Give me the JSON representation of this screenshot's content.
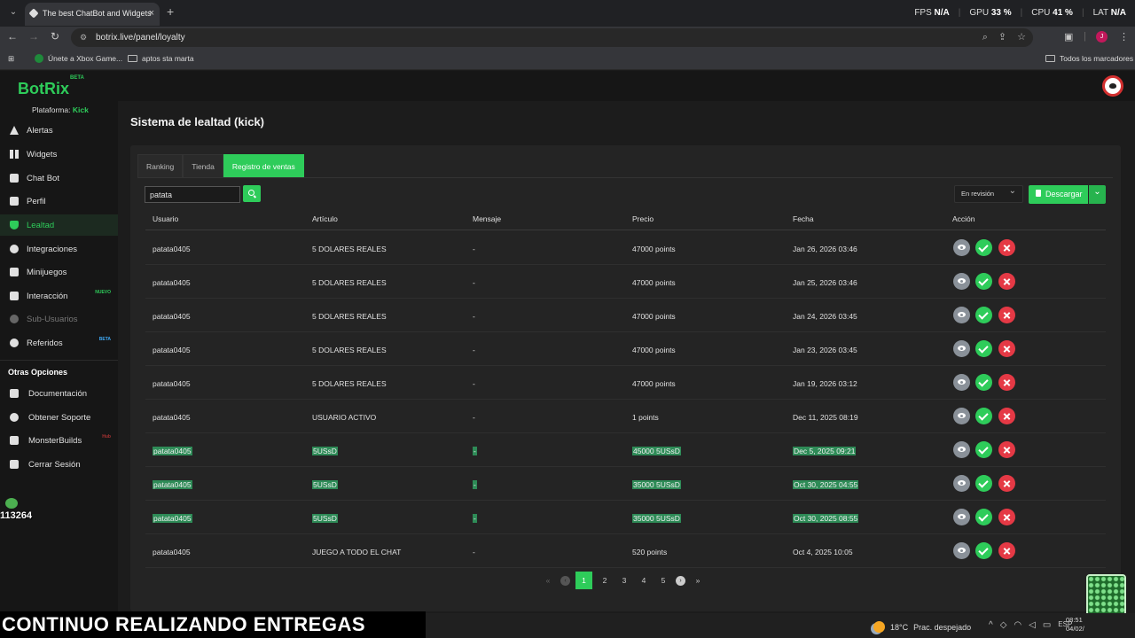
{
  "browser": {
    "tab_title": "The best ChatBot and Widgets",
    "new_tab": "+",
    "url": "botrix.live/panel/loyalty",
    "perf": [
      {
        "label": "FPS",
        "value": "N/A"
      },
      {
        "label": "GPU",
        "value": "33 %"
      },
      {
        "label": "CPU",
        "value": "41 %"
      },
      {
        "label": "LAT",
        "value": "N/A"
      }
    ],
    "profile_initial": "J",
    "bookmarks": [
      "Únete a Xbox Game...",
      "aptos sta marta"
    ],
    "all_bookmarks": "Todos los marcadores"
  },
  "app": {
    "logo": "BotRix",
    "logo_badge": "BETA",
    "platform_label": "Plataforma:",
    "platform_value": "Kick"
  },
  "sidebar": {
    "items": [
      {
        "label": "Alertas",
        "icon": "alert-icon"
      },
      {
        "label": "Widgets",
        "icon": "widgets-icon"
      },
      {
        "label": "Chat Bot",
        "icon": "chatbot-icon"
      },
      {
        "label": "Perfil",
        "icon": "profile-icon"
      },
      {
        "label": "Lealtad",
        "icon": "trophy-icon"
      },
      {
        "label": "Integraciones",
        "icon": "integrations-icon"
      },
      {
        "label": "Minijuegos",
        "icon": "gamepad-icon"
      },
      {
        "label": "Interacción",
        "icon": "music-icon",
        "badge": "NUEVO"
      },
      {
        "label": "Sub-Usuarios",
        "icon": "subusers-icon"
      },
      {
        "label": "Referidos",
        "icon": "referrals-icon",
        "badge": "BETA"
      }
    ],
    "other_title": "Otras Opciones",
    "other_items": [
      {
        "label": "Documentación",
        "icon": "docs-icon"
      },
      {
        "label": "Obtener Soporte",
        "icon": "support-icon"
      },
      {
        "label": "MonsterBuilds",
        "icon": "monitor-icon",
        "badge": "Hub"
      },
      {
        "label": "Cerrar Sesión",
        "icon": "logout-icon"
      }
    ]
  },
  "page": {
    "title": "Sistema de lealtad (kick)",
    "tabs": [
      "Ranking",
      "Tienda",
      "Registro de ventas"
    ],
    "active_tab": "Registro de ventas",
    "search_value": "patata",
    "status_filter": "En revisión",
    "download_label": "Descargar"
  },
  "table": {
    "headers": [
      "Usuario",
      "Artículo",
      "Mensaje",
      "Precio",
      "Fecha",
      "Acción"
    ],
    "rows": [
      {
        "user": "patata0405",
        "item": "5 DOLARES REALES",
        "message": "-",
        "price": "47000 points",
        "date": "Jan 26, 2026 03:46",
        "highlighted": false
      },
      {
        "user": "patata0405",
        "item": "5 DOLARES REALES",
        "message": "-",
        "price": "47000 points",
        "date": "Jan 25, 2026 03:46",
        "highlighted": false
      },
      {
        "user": "patata0405",
        "item": "5 DOLARES REALES",
        "message": "-",
        "price": "47000 points",
        "date": "Jan 24, 2026 03:45",
        "highlighted": false
      },
      {
        "user": "patata0405",
        "item": "5 DOLARES REALES",
        "message": "-",
        "price": "47000 points",
        "date": "Jan 23, 2026 03:45",
        "highlighted": false
      },
      {
        "user": "patata0405",
        "item": "5 DOLARES REALES",
        "message": "-",
        "price": "47000 points",
        "date": "Jan 19, 2026 03:12",
        "highlighted": false
      },
      {
        "user": "patata0405",
        "item": "USUARIO ACTIVO",
        "message": "-",
        "price": "1 points",
        "date": "Dec 11, 2025 08:19",
        "highlighted": false
      },
      {
        "user": "patata0405",
        "item": "5USsD",
        "message": "-",
        "price": "45000 5USsD",
        "date": "Dec 5, 2025 09:21",
        "highlighted": true
      },
      {
        "user": "patata0405",
        "item": "5USsD",
        "message": "-",
        "price": "35000 5USsD",
        "date": "Oct 30, 2025 04:55",
        "highlighted": true
      },
      {
        "user": "patata0405",
        "item": "5USsD",
        "message": "-",
        "price": "35000 5USsD",
        "date": "Oct 30, 2025 08:55",
        "highlighted": true
      },
      {
        "user": "patata0405",
        "item": "JUEGO A TODO EL CHAT",
        "message": "-",
        "price": "520 points",
        "date": "Oct 4, 2025 10:05",
        "highlighted": false
      }
    ]
  },
  "pagination": {
    "first": "«",
    "prev": "‹",
    "pages": [
      "1",
      "2",
      "3",
      "4",
      "5"
    ],
    "current": "1",
    "next": "›",
    "last": "»"
  },
  "overlay": {
    "caption": "CONTINUO REALIZANDO ENTREGAS",
    "counter": "113264"
  },
  "taskbar": {
    "weather_temp": "18°C",
    "weather_desc": "Prac. despejado",
    "language": "ESP",
    "time": "08:51",
    "date": "04/02/"
  },
  "colors": {
    "accent": "#2ecc5a",
    "danger": "#e53945",
    "muted": "#8a9199"
  }
}
